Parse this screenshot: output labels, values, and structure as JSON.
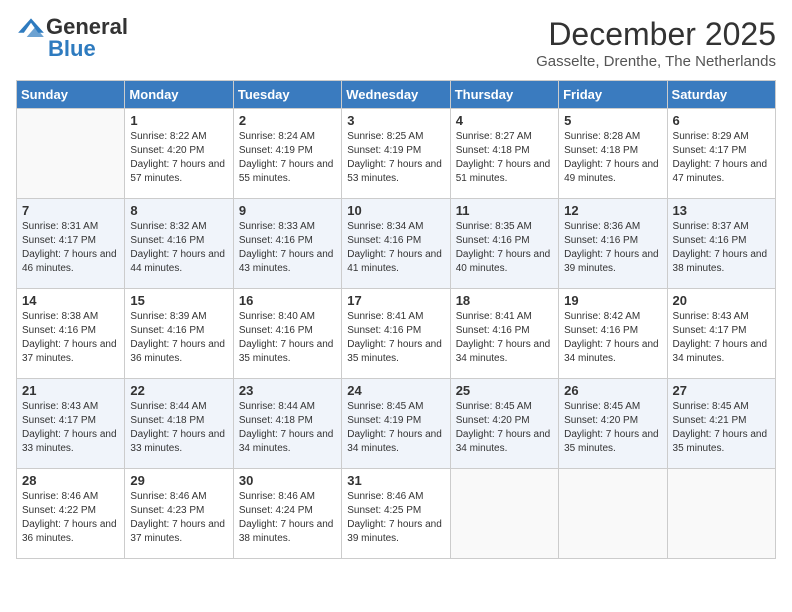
{
  "header": {
    "logo_general": "General",
    "logo_blue": "Blue",
    "month_title": "December 2025",
    "location": "Gasselte, Drenthe, The Netherlands"
  },
  "days_of_week": [
    "Sunday",
    "Monday",
    "Tuesday",
    "Wednesday",
    "Thursday",
    "Friday",
    "Saturday"
  ],
  "weeks": [
    [
      {
        "day": "",
        "sunrise": "",
        "sunset": "",
        "daylight": "",
        "empty": true
      },
      {
        "day": "1",
        "sunrise": "Sunrise: 8:22 AM",
        "sunset": "Sunset: 4:20 PM",
        "daylight": "Daylight: 7 hours and 57 minutes."
      },
      {
        "day": "2",
        "sunrise": "Sunrise: 8:24 AM",
        "sunset": "Sunset: 4:19 PM",
        "daylight": "Daylight: 7 hours and 55 minutes."
      },
      {
        "day": "3",
        "sunrise": "Sunrise: 8:25 AM",
        "sunset": "Sunset: 4:19 PM",
        "daylight": "Daylight: 7 hours and 53 minutes."
      },
      {
        "day": "4",
        "sunrise": "Sunrise: 8:27 AM",
        "sunset": "Sunset: 4:18 PM",
        "daylight": "Daylight: 7 hours and 51 minutes."
      },
      {
        "day": "5",
        "sunrise": "Sunrise: 8:28 AM",
        "sunset": "Sunset: 4:18 PM",
        "daylight": "Daylight: 7 hours and 49 minutes."
      },
      {
        "day": "6",
        "sunrise": "Sunrise: 8:29 AM",
        "sunset": "Sunset: 4:17 PM",
        "daylight": "Daylight: 7 hours and 47 minutes."
      }
    ],
    [
      {
        "day": "7",
        "sunrise": "Sunrise: 8:31 AM",
        "sunset": "Sunset: 4:17 PM",
        "daylight": "Daylight: 7 hours and 46 minutes."
      },
      {
        "day": "8",
        "sunrise": "Sunrise: 8:32 AM",
        "sunset": "Sunset: 4:16 PM",
        "daylight": "Daylight: 7 hours and 44 minutes."
      },
      {
        "day": "9",
        "sunrise": "Sunrise: 8:33 AM",
        "sunset": "Sunset: 4:16 PM",
        "daylight": "Daylight: 7 hours and 43 minutes."
      },
      {
        "day": "10",
        "sunrise": "Sunrise: 8:34 AM",
        "sunset": "Sunset: 4:16 PM",
        "daylight": "Daylight: 7 hours and 41 minutes."
      },
      {
        "day": "11",
        "sunrise": "Sunrise: 8:35 AM",
        "sunset": "Sunset: 4:16 PM",
        "daylight": "Daylight: 7 hours and 40 minutes."
      },
      {
        "day": "12",
        "sunrise": "Sunrise: 8:36 AM",
        "sunset": "Sunset: 4:16 PM",
        "daylight": "Daylight: 7 hours and 39 minutes."
      },
      {
        "day": "13",
        "sunrise": "Sunrise: 8:37 AM",
        "sunset": "Sunset: 4:16 PM",
        "daylight": "Daylight: 7 hours and 38 minutes."
      }
    ],
    [
      {
        "day": "14",
        "sunrise": "Sunrise: 8:38 AM",
        "sunset": "Sunset: 4:16 PM",
        "daylight": "Daylight: 7 hours and 37 minutes."
      },
      {
        "day": "15",
        "sunrise": "Sunrise: 8:39 AM",
        "sunset": "Sunset: 4:16 PM",
        "daylight": "Daylight: 7 hours and 36 minutes."
      },
      {
        "day": "16",
        "sunrise": "Sunrise: 8:40 AM",
        "sunset": "Sunset: 4:16 PM",
        "daylight": "Daylight: 7 hours and 35 minutes."
      },
      {
        "day": "17",
        "sunrise": "Sunrise: 8:41 AM",
        "sunset": "Sunset: 4:16 PM",
        "daylight": "Daylight: 7 hours and 35 minutes."
      },
      {
        "day": "18",
        "sunrise": "Sunrise: 8:41 AM",
        "sunset": "Sunset: 4:16 PM",
        "daylight": "Daylight: 7 hours and 34 minutes."
      },
      {
        "day": "19",
        "sunrise": "Sunrise: 8:42 AM",
        "sunset": "Sunset: 4:16 PM",
        "daylight": "Daylight: 7 hours and 34 minutes."
      },
      {
        "day": "20",
        "sunrise": "Sunrise: 8:43 AM",
        "sunset": "Sunset: 4:17 PM",
        "daylight": "Daylight: 7 hours and 34 minutes."
      }
    ],
    [
      {
        "day": "21",
        "sunrise": "Sunrise: 8:43 AM",
        "sunset": "Sunset: 4:17 PM",
        "daylight": "Daylight: 7 hours and 33 minutes."
      },
      {
        "day": "22",
        "sunrise": "Sunrise: 8:44 AM",
        "sunset": "Sunset: 4:18 PM",
        "daylight": "Daylight: 7 hours and 33 minutes."
      },
      {
        "day": "23",
        "sunrise": "Sunrise: 8:44 AM",
        "sunset": "Sunset: 4:18 PM",
        "daylight": "Daylight: 7 hours and 34 minutes."
      },
      {
        "day": "24",
        "sunrise": "Sunrise: 8:45 AM",
        "sunset": "Sunset: 4:19 PM",
        "daylight": "Daylight: 7 hours and 34 minutes."
      },
      {
        "day": "25",
        "sunrise": "Sunrise: 8:45 AM",
        "sunset": "Sunset: 4:20 PM",
        "daylight": "Daylight: 7 hours and 34 minutes."
      },
      {
        "day": "26",
        "sunrise": "Sunrise: 8:45 AM",
        "sunset": "Sunset: 4:20 PM",
        "daylight": "Daylight: 7 hours and 35 minutes."
      },
      {
        "day": "27",
        "sunrise": "Sunrise: 8:45 AM",
        "sunset": "Sunset: 4:21 PM",
        "daylight": "Daylight: 7 hours and 35 minutes."
      }
    ],
    [
      {
        "day": "28",
        "sunrise": "Sunrise: 8:46 AM",
        "sunset": "Sunset: 4:22 PM",
        "daylight": "Daylight: 7 hours and 36 minutes."
      },
      {
        "day": "29",
        "sunrise": "Sunrise: 8:46 AM",
        "sunset": "Sunset: 4:23 PM",
        "daylight": "Daylight: 7 hours and 37 minutes."
      },
      {
        "day": "30",
        "sunrise": "Sunrise: 8:46 AM",
        "sunset": "Sunset: 4:24 PM",
        "daylight": "Daylight: 7 hours and 38 minutes."
      },
      {
        "day": "31",
        "sunrise": "Sunrise: 8:46 AM",
        "sunset": "Sunset: 4:25 PM",
        "daylight": "Daylight: 7 hours and 39 minutes."
      },
      {
        "day": "",
        "sunrise": "",
        "sunset": "",
        "daylight": "",
        "empty": true
      },
      {
        "day": "",
        "sunrise": "",
        "sunset": "",
        "daylight": "",
        "empty": true
      },
      {
        "day": "",
        "sunrise": "",
        "sunset": "",
        "daylight": "",
        "empty": true
      }
    ]
  ]
}
